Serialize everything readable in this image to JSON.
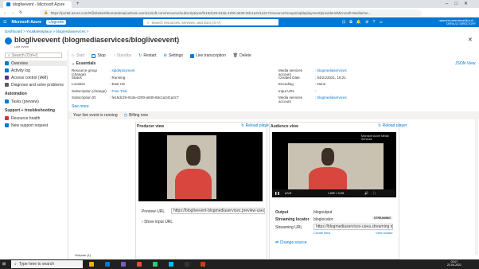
{
  "browser": {
    "tab_title": "bloglivevent - Microsoft Azure",
    "new_tab": "+",
    "url": "https://portal.azure.com/#@drakeshkumardesaioutlook.onmicrosoft.com/resource/subscriptions/fe15dc29-81da-4200-a630-8dc1a241a2c7/resourceGroups/sqldeployment/providers/Microsoft.Media/me..."
  },
  "azure": {
    "brand": "Microsoft Azure",
    "upgrade": "Upgrade",
    "search_placeholder": "Search resources, services, and docs (G+/)",
    "account_name": "rakeshkumardesai@outl...",
    "account_dir": "DEFAULT DIRECTORY"
  },
  "breadcrumb": "Dashboard > YouMarketplace > blogmediaservices >",
  "page": {
    "title": "blogliveevent (blogmediaservices/blogliveevent)",
    "subtitle": "Live event"
  },
  "sidebar": {
    "search_placeholder": "Search (Ctrl+/)",
    "items": [
      {
        "label": "Overview",
        "color": "#0078d4"
      },
      {
        "label": "Activity log",
        "color": "#0078d4"
      },
      {
        "label": "Access control (IAM)",
        "color": "#5c2d91"
      },
      {
        "label": "Diagnose and solve problems",
        "color": "#605e5c"
      }
    ],
    "automation_header": "Automation",
    "automation_items": [
      {
        "label": "Tasks (preview)",
        "color": "#0078d4"
      }
    ],
    "support_header": "Support + troubleshooting",
    "support_items": [
      {
        "label": "Resource health",
        "color": "#d13438"
      },
      {
        "label": "New support request",
        "color": "#0078d4"
      }
    ]
  },
  "toolbar": {
    "start": "Start",
    "stop": "Stop",
    "standby": "Standby",
    "restart": "Restart",
    "settings": "Settings",
    "live_transcription": "Live transcription",
    "delete": "Delete"
  },
  "essentials": {
    "header": "Essentials",
    "json_view": "JSON View",
    "left": [
      {
        "k": "Resource group (change)",
        "v": "sqldeployment",
        "link": true
      },
      {
        "k": "Status",
        "v": "Running",
        "link": false
      },
      {
        "k": "Location",
        "v": "East US",
        "link": false
      },
      {
        "k": "Subscription (change)",
        "v": "Free Trial",
        "link": true
      },
      {
        "k": "Subscription ID",
        "v": "fe15dc29-81da-4200-a630-8dc1a241a2c7",
        "link": false
      }
    ],
    "right": [
      {
        "k": "Media services account",
        "v": "blogmediaservices",
        "link": true
      },
      {
        "k": "Created Date",
        "v": "04/21/2021, 18:21",
        "link": false
      },
      {
        "k": "Encoding",
        "v": "None",
        "link": false
      },
      {
        "k": "Input URL",
        "v": "",
        "link": false
      },
      {
        "k": "Media services account",
        "v": "blogmediaservices",
        "link": true
      }
    ],
    "see_more": "See more"
  },
  "status": {
    "live_text": "Your live event is running",
    "billing": "Billing now"
  },
  "producer": {
    "title": "Producer view",
    "reload": "Reload player",
    "preview_url_label": "Preview URL",
    "preview_url_value": "https://bloglivevent-blogmediaservices.preview-usea...",
    "show_input_url": "Show input URL"
  },
  "audience": {
    "title": "Audience view",
    "reload": "Reload player",
    "watermark": "Microsoft Azure Media Services",
    "live_badge": "LIVE",
    "player_time": "LIVE / 3:29",
    "output_label": "Output",
    "output_value": "blogoutput",
    "locator_label": "Streaming locator",
    "locator_value": "bloglocator",
    "streaming_badge": "STREAMING",
    "streaming_url_label": "Streaming URL",
    "streaming_url_value": "https://blogmediaservices-usea.streaming.media...",
    "create_new": "Create New",
    "view_locator": "View locator",
    "change_source": "Change source"
  },
  "taskbar": {
    "search_placeholder": "Type here to search",
    "time": "01:07",
    "date": "22-04-2021",
    "apps_colors": [
      "#f0b400",
      "#0078d4",
      "#7b5cbf",
      "#e74c3c",
      "#2ecc71",
      "#00bcf2",
      "#333333",
      "#c43e1c"
    ]
  },
  "footer_label": "Outputs (1)"
}
